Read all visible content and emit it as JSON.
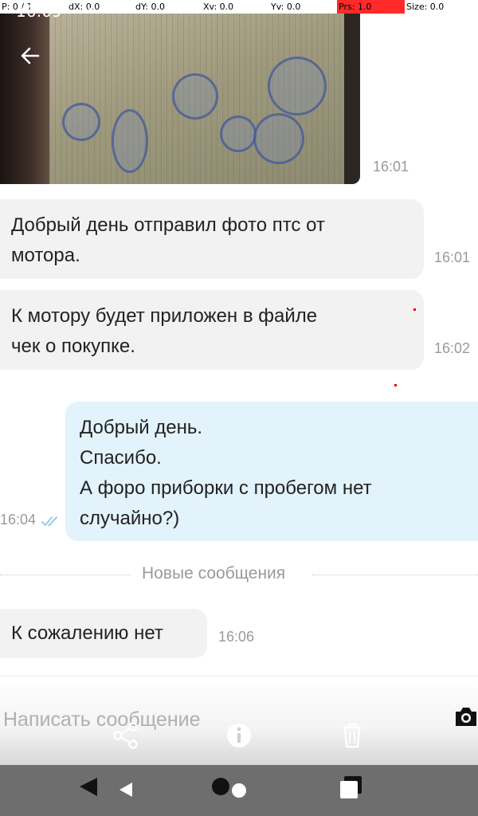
{
  "debug": {
    "p": "P: 0 / 1",
    "dx": "dX: 0.0",
    "dy": "dY: 0.0",
    "xv": "Xv: 0.0",
    "yv": "Yv: 0.0",
    "prs": "Prs: 1.0",
    "size": "Size: 0.0"
  },
  "status_bar": {
    "clock": "16:09"
  },
  "photo": {
    "time": "16:01"
  },
  "messages": [
    {
      "direction": "incoming",
      "lines": [
        "Добрый день отправил фото птс от",
        "мотора."
      ],
      "time": "16:01"
    },
    {
      "direction": "incoming",
      "lines": [
        "К мотору будет приложен в файле",
        "чек о покупке."
      ],
      "time": "16:02"
    },
    {
      "direction": "outgoing",
      "lines": [
        "Добрый день.",
        "Спасибо.",
        "А форо приборки с пробегом нет",
        "случайно?)"
      ],
      "time": "16:04",
      "status": "read"
    }
  ],
  "divider": {
    "label": "Новые сообщения"
  },
  "new_messages": [
    {
      "direction": "incoming",
      "lines": [
        "К сожалению нет"
      ],
      "time": "16:06"
    }
  ],
  "composer": {
    "placeholder": "Написать сообщение"
  },
  "icons": {
    "back": "arrow-left-icon",
    "more": "more-vertical-icon",
    "camera": "camera-icon",
    "share": "share-icon",
    "info": "info-icon",
    "trash": "trash-icon",
    "read_status": "double-check-icon"
  },
  "colors": {
    "incoming_bubble": "#f2f2f2",
    "outgoing_bubble": "#e2f3fc",
    "read_check": "#8ec5e6",
    "debug_pressure": "#ff2a2a"
  }
}
